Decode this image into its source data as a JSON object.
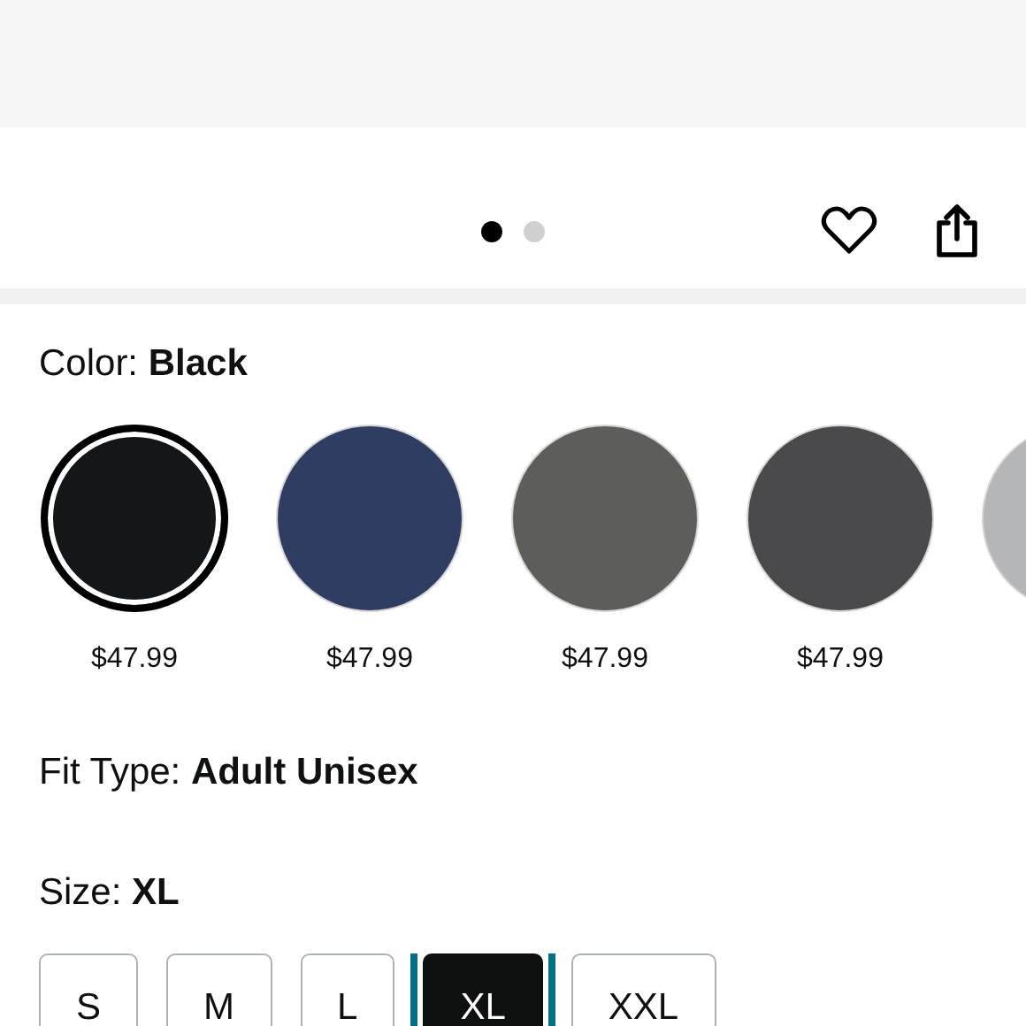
{
  "gallery": {
    "dots": [
      {
        "selected": true
      },
      {
        "selected": false
      }
    ]
  },
  "color": {
    "label": "Color: ",
    "value": "Black",
    "swatches": [
      {
        "color": "#14171a",
        "selected": true,
        "price": "$47.99"
      },
      {
        "color": "#2f3d63",
        "selected": false,
        "price": "$47.99"
      },
      {
        "color": "#5d5d5a",
        "selected": false,
        "price": "$47.99"
      },
      {
        "color": "#4a4a4c",
        "selected": false,
        "price": "$47.99"
      },
      {
        "color": "#b5b6b8",
        "selected": false
      }
    ]
  },
  "fit_type": {
    "label": "Fit Type: ",
    "value": "Adult Unisex"
  },
  "size": {
    "label": "Size: ",
    "value": "XL",
    "options": [
      {
        "label": "S",
        "selected": false
      },
      {
        "label": "M",
        "selected": false
      },
      {
        "label": "L",
        "selected": false
      },
      {
        "label": "XL",
        "selected": true
      },
      {
        "label": "XXL",
        "selected": false
      }
    ]
  }
}
